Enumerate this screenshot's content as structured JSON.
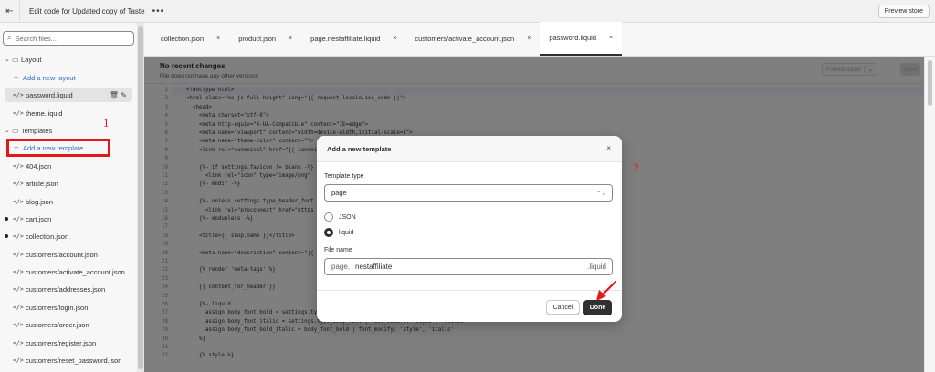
{
  "topbar": {
    "title": "Edit code for Updated copy of Taste",
    "more": "•••",
    "preview": "Preview store"
  },
  "sidebar": {
    "search_placeholder": "Search files...",
    "layout_label": "Layout",
    "add_layout": "Add a new layout",
    "files_layout": [
      "password.liquid",
      "theme.liquid"
    ],
    "templates_label": "Templates",
    "add_template": "Add a new template",
    "files_templates": [
      "404.json",
      "article.json",
      "blog.json",
      "cart.json",
      "collection.json",
      "customers/account.json",
      "customers/activate_account.json",
      "customers/addresses.json",
      "customers/login.json",
      "customers/order.json",
      "customers/register.json",
      "customers/reset_password.json"
    ]
  },
  "tabs": [
    "collection.json",
    "product.json",
    "page.nestaffiliate.liquid",
    "customers/activate_account.json",
    "password.liquid"
  ],
  "subheader": {
    "heading": "No recent changes",
    "sub": "File does not have any other versions",
    "format": "Format liquid",
    "save": "Save"
  },
  "code": [
    {
      "n": "1",
      "t": "<!doctype html>"
    },
    {
      "n": "2",
      "t": "<html class=\"no-js full-height\" lang=\"{{ request.locale.iso_code }}\">"
    },
    {
      "n": "3",
      "t": "  <head>"
    },
    {
      "n": "4",
      "t": "    <meta charset=\"utf-8\">"
    },
    {
      "n": "5",
      "t": "    <meta http-equiv=\"X-UA-Compatible\" content=\"IE=edge\">"
    },
    {
      "n": "6",
      "t": "    <meta name=\"viewport\" content=\"width=device-width,initial-scale=1\">"
    },
    {
      "n": "7",
      "t": "    <meta name=\"theme-color\" content=\"\">"
    },
    {
      "n": "8",
      "t": "    <link rel=\"canonical\" href=\"{{ canonical_url }}\">"
    },
    {
      "n": "9",
      "t": ""
    },
    {
      "n": "10",
      "t": "    {%- if settings.favicon != blank -%}"
    },
    {
      "n": "11",
      "t": "      <link rel=\"icon\" type=\"image/png\""
    },
    {
      "n": "12",
      "t": "    {%- endif -%}"
    },
    {
      "n": "13",
      "t": ""
    },
    {
      "n": "14",
      "t": "    {%- unless settings.type_header_font"
    },
    {
      "n": "15",
      "t": "      <link rel=\"preconnect\" href=\"https"
    },
    {
      "n": "16",
      "t": "    {%- endunless -%}"
    },
    {
      "n": "17",
      "t": ""
    },
    {
      "n": "18",
      "t": "    <title>{{ shop.name }}</title>"
    },
    {
      "n": "19",
      "t": ""
    },
    {
      "n": "20",
      "t": "    <meta name=\"description\" content=\"{{"
    },
    {
      "n": "21",
      "t": ""
    },
    {
      "n": "22",
      "t": "    {% render 'meta-tags' %}"
    },
    {
      "n": "23",
      "t": ""
    },
    {
      "n": "24",
      "t": "    {{ content_for_header }}"
    },
    {
      "n": "25",
      "t": ""
    },
    {
      "n": "26",
      "t": "    {%- liquid"
    },
    {
      "n": "27",
      "t": "      assign body_font_bold = settings.type_body_font | font_modify: 'weight', 'bold'"
    },
    {
      "n": "28",
      "t": "      assign body_font_italic = settings.type_body_font | font_modify: 'style', 'italic'"
    },
    {
      "n": "29",
      "t": "      assign body_font_bold_italic = body_font_bold | font_modify: 'style', 'italic'"
    },
    {
      "n": "30",
      "t": "    %}"
    },
    {
      "n": "31",
      "t": ""
    },
    {
      "n": "32",
      "t": "    {% style %}"
    }
  ],
  "modal": {
    "title": "Add a new template",
    "close": "×",
    "type_label": "Template type",
    "type_value": "page",
    "radio_json": "JSON",
    "radio_liquid": "liquid",
    "fname_label": "File name",
    "fname_prefix": "page.",
    "fname_value": "nestaffiliate",
    "fname_suffix": ".liquid",
    "cancel": "Cancel",
    "done": "Done"
  },
  "annotations": {
    "one": "1",
    "two": "2",
    "color": "#e31919"
  }
}
